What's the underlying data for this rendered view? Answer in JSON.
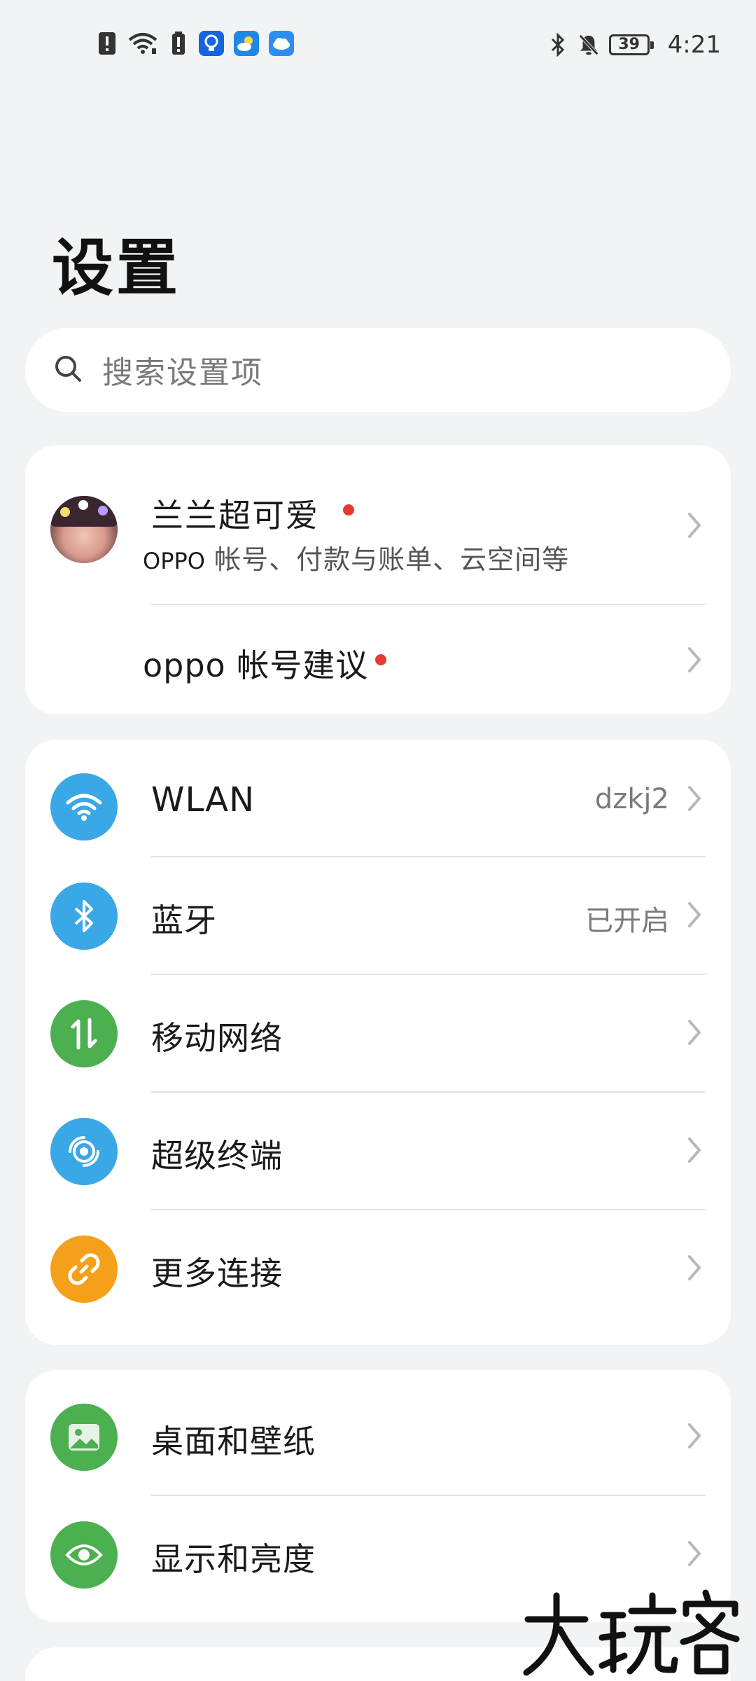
{
  "status_bar": {
    "left_icons": [
      "alert-icon",
      "wifi-icon",
      "battery-alert-icon",
      "bulb-app-icon",
      "weather-app-icon",
      "cloud-app-icon"
    ],
    "right_icons": [
      "bluetooth-icon",
      "bell-off-icon"
    ],
    "battery_level": "39",
    "time": "4:21"
  },
  "header": {
    "title": "设置"
  },
  "search": {
    "placeholder": "搜索设置项"
  },
  "account": {
    "name": "兰兰超可爱",
    "subtitle_brand": "OPPO",
    "subtitle": "帐号、付款与账单、云空间等",
    "suggestion": "oppo 帐号建议"
  },
  "connectivity": [
    {
      "label": "WLAN",
      "value": "dzkj2",
      "icon": "wifi-icon",
      "color": "#3aa7e6"
    },
    {
      "label": "蓝牙",
      "value": "已开启",
      "icon": "bluetooth-icon",
      "color": "#3aa7e6"
    },
    {
      "label": "移动网络",
      "value": "",
      "icon": "mobile-data-icon",
      "color": "#4caf50"
    },
    {
      "label": "超级终端",
      "value": "",
      "icon": "super-device-icon",
      "color": "#3aa7e6"
    },
    {
      "label": "更多连接",
      "value": "",
      "icon": "link-icon",
      "color": "#f5a01a"
    }
  ],
  "display": [
    {
      "label": "桌面和壁纸",
      "icon": "wallpaper-icon",
      "color": "#4caf50"
    },
    {
      "label": "显示和亮度",
      "icon": "eye-icon",
      "color": "#4caf50"
    }
  ],
  "watermark": "大玩客"
}
